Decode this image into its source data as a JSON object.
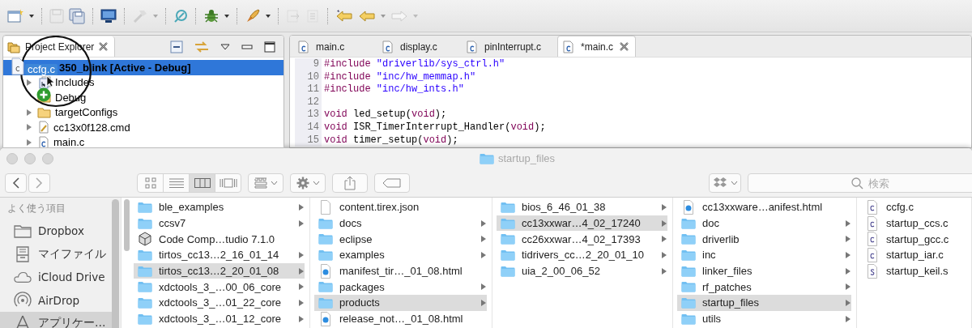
{
  "project_explorer": {
    "tab": {
      "label": "Project Explorer"
    },
    "tree": [
      {
        "label": "350_blink  [Active - Debug]",
        "selected": true,
        "children": [
          {
            "label": "Includes",
            "kind": "includes",
            "expandable": true,
            "selected": false
          },
          {
            "label": "Debug",
            "kind": "folder",
            "expandable": false,
            "selected": false
          },
          {
            "label": "targetConfigs",
            "kind": "folder",
            "expandable": true,
            "selected": false
          },
          {
            "label": "cc13x0f128.cmd",
            "kind": "cmd",
            "expandable": true,
            "selected": false
          },
          {
            "label": "main.c",
            "kind": "c",
            "expandable": true,
            "selected": false
          }
        ]
      }
    ]
  },
  "drag_item": {
    "label": "ccfg.c"
  },
  "editor": {
    "tabs": [
      {
        "label": "main.c",
        "selected": false
      },
      {
        "label": "display.c",
        "selected": false
      },
      {
        "label": "pinInterrupt.c",
        "selected": false
      },
      {
        "label": "*main.c",
        "selected": true
      }
    ],
    "lines": [
      {
        "number": "9",
        "tokens": [
          {
            "kind": "directive",
            "text": "#include "
          },
          {
            "kind": "string",
            "text": "\"driverlib/sys_ctrl.h\""
          }
        ]
      },
      {
        "number": "10",
        "tokens": [
          {
            "kind": "directive",
            "text": "#include "
          },
          {
            "kind": "string",
            "text": "\"inc/hw_memmap.h\""
          }
        ]
      },
      {
        "number": "11",
        "tokens": [
          {
            "kind": "directive",
            "text": "#include "
          },
          {
            "kind": "string",
            "text": "\"inc/hw_ints.h\""
          }
        ]
      },
      {
        "number": "12"
      },
      {
        "number": "13",
        "tokens": [
          {
            "kind": "keyword",
            "text": "void"
          },
          {
            "kind": "plain",
            "text": " led_setup("
          },
          {
            "kind": "keyword",
            "text": "void"
          },
          {
            "kind": "plain",
            "text": ");"
          }
        ]
      },
      {
        "number": "14",
        "tokens": [
          {
            "kind": "keyword",
            "text": "void"
          },
          {
            "kind": "plain",
            "text": " ISR_TimerInterrupt_Handler("
          },
          {
            "kind": "keyword",
            "text": "void"
          },
          {
            "kind": "plain",
            "text": ");"
          }
        ]
      },
      {
        "number": "15",
        "tokens": [
          {
            "kind": "keyword",
            "text": "void"
          },
          {
            "kind": "plain",
            "text": " timer_setup("
          },
          {
            "kind": "keyword",
            "text": "void"
          },
          {
            "kind": "plain",
            "text": ");"
          }
        ]
      }
    ]
  },
  "finder": {
    "title": "startup_files",
    "view_buttons": [
      {
        "kind": "icons",
        "selected": false
      },
      {
        "kind": "list",
        "selected": false
      },
      {
        "kind": "columns",
        "selected": true
      },
      {
        "kind": "gallery",
        "selected": false
      }
    ],
    "search": {
      "placeholder": "検索"
    },
    "sidebar": {
      "heading": "よく使う項目",
      "items": [
        {
          "label": "Dropbox",
          "kind": "folder",
          "selected": false
        },
        {
          "label": "マイファイル",
          "kind": "files",
          "selected": false
        },
        {
          "label": "iCloud Drive",
          "kind": "cloud",
          "selected": false
        },
        {
          "label": "AirDrop",
          "kind": "airdrop",
          "selected": false
        },
        {
          "label": "アプリケー…",
          "kind": "apps",
          "selected": true
        }
      ]
    },
    "columns": [
      {
        "items": [
          {
            "label": "ble_examples",
            "kind": "folder",
            "has_children": true,
            "selected": false
          },
          {
            "label": "ccsv7",
            "kind": "folder",
            "has_children": true,
            "selected": false
          },
          {
            "label": "Code Comp…tudio 7.1.0",
            "kind": "app",
            "has_children": false,
            "selected": false
          },
          {
            "label": "tirtos_cc13…2_16_01_14",
            "kind": "folder",
            "has_children": true,
            "selected": false
          },
          {
            "label": "tirtos_cc13…2_20_01_08",
            "kind": "folder",
            "has_children": true,
            "selected": true
          },
          {
            "label": "xdctools_3_…00_06_core",
            "kind": "folder",
            "has_children": true,
            "selected": false
          },
          {
            "label": "xdctools_3_…01_22_core",
            "kind": "folder",
            "has_children": true,
            "selected": false
          },
          {
            "label": "xdctools_3_…01_12_core",
            "kind": "folder",
            "has_children": true,
            "selected": false
          }
        ]
      },
      {
        "items": [
          {
            "label": "content.tirex.json",
            "kind": "file",
            "has_children": false,
            "selected": false
          },
          {
            "label": "docs",
            "kind": "folder",
            "has_children": true,
            "selected": false
          },
          {
            "label": "eclipse",
            "kind": "folder",
            "has_children": true,
            "selected": false
          },
          {
            "label": "examples",
            "kind": "folder",
            "has_children": true,
            "selected": false
          },
          {
            "label": "manifest_tir…_01_08.html",
            "kind": "html",
            "has_children": false,
            "selected": false
          },
          {
            "label": "packages",
            "kind": "folder",
            "has_children": true,
            "selected": false
          },
          {
            "label": "products",
            "kind": "folder",
            "has_children": true,
            "selected": true
          },
          {
            "label": "release_not…_01_08.html",
            "kind": "html",
            "has_children": false,
            "selected": false
          }
        ]
      },
      {
        "items": [
          {
            "label": "bios_6_46_01_38",
            "kind": "folder",
            "has_children": true,
            "selected": false
          },
          {
            "label": "cc13xxwar…4_02_17240",
            "kind": "folder",
            "has_children": true,
            "selected": true
          },
          {
            "label": "cc26xxwar…4_02_17393",
            "kind": "folder",
            "has_children": true,
            "selected": false
          },
          {
            "label": "tidrivers_cc…2_20_01_10",
            "kind": "folder",
            "has_children": true,
            "selected": false
          },
          {
            "label": "uia_2_00_06_52",
            "kind": "folder",
            "has_children": true,
            "selected": false
          }
        ]
      },
      {
        "items": [
          {
            "label": "cc13xxware…anifest.html",
            "kind": "html",
            "has_children": false,
            "selected": false
          },
          {
            "label": "doc",
            "kind": "folder",
            "has_children": true,
            "selected": false
          },
          {
            "label": "driverlib",
            "kind": "folder",
            "has_children": true,
            "selected": false
          },
          {
            "label": "inc",
            "kind": "folder",
            "has_children": true,
            "selected": false
          },
          {
            "label": "linker_files",
            "kind": "folder",
            "has_children": true,
            "selected": false
          },
          {
            "label": "rf_patches",
            "kind": "folder",
            "has_children": true,
            "selected": false
          },
          {
            "label": "startup_files",
            "kind": "folder",
            "has_children": true,
            "selected": true
          },
          {
            "label": "utils",
            "kind": "folder",
            "has_children": true,
            "selected": false
          }
        ]
      },
      {
        "items": [
          {
            "label": "ccfg.c",
            "kind": "c",
            "has_children": false,
            "selected": false
          },
          {
            "label": "startup_ccs.c",
            "kind": "c",
            "has_children": false,
            "selected": false
          },
          {
            "label": "startup_gcc.c",
            "kind": "c",
            "has_children": false,
            "selected": false
          },
          {
            "label": "startup_iar.c",
            "kind": "c",
            "has_children": false,
            "selected": false
          },
          {
            "label": "startup_keil.s",
            "kind": "s",
            "has_children": false,
            "selected": false
          }
        ]
      }
    ]
  }
}
